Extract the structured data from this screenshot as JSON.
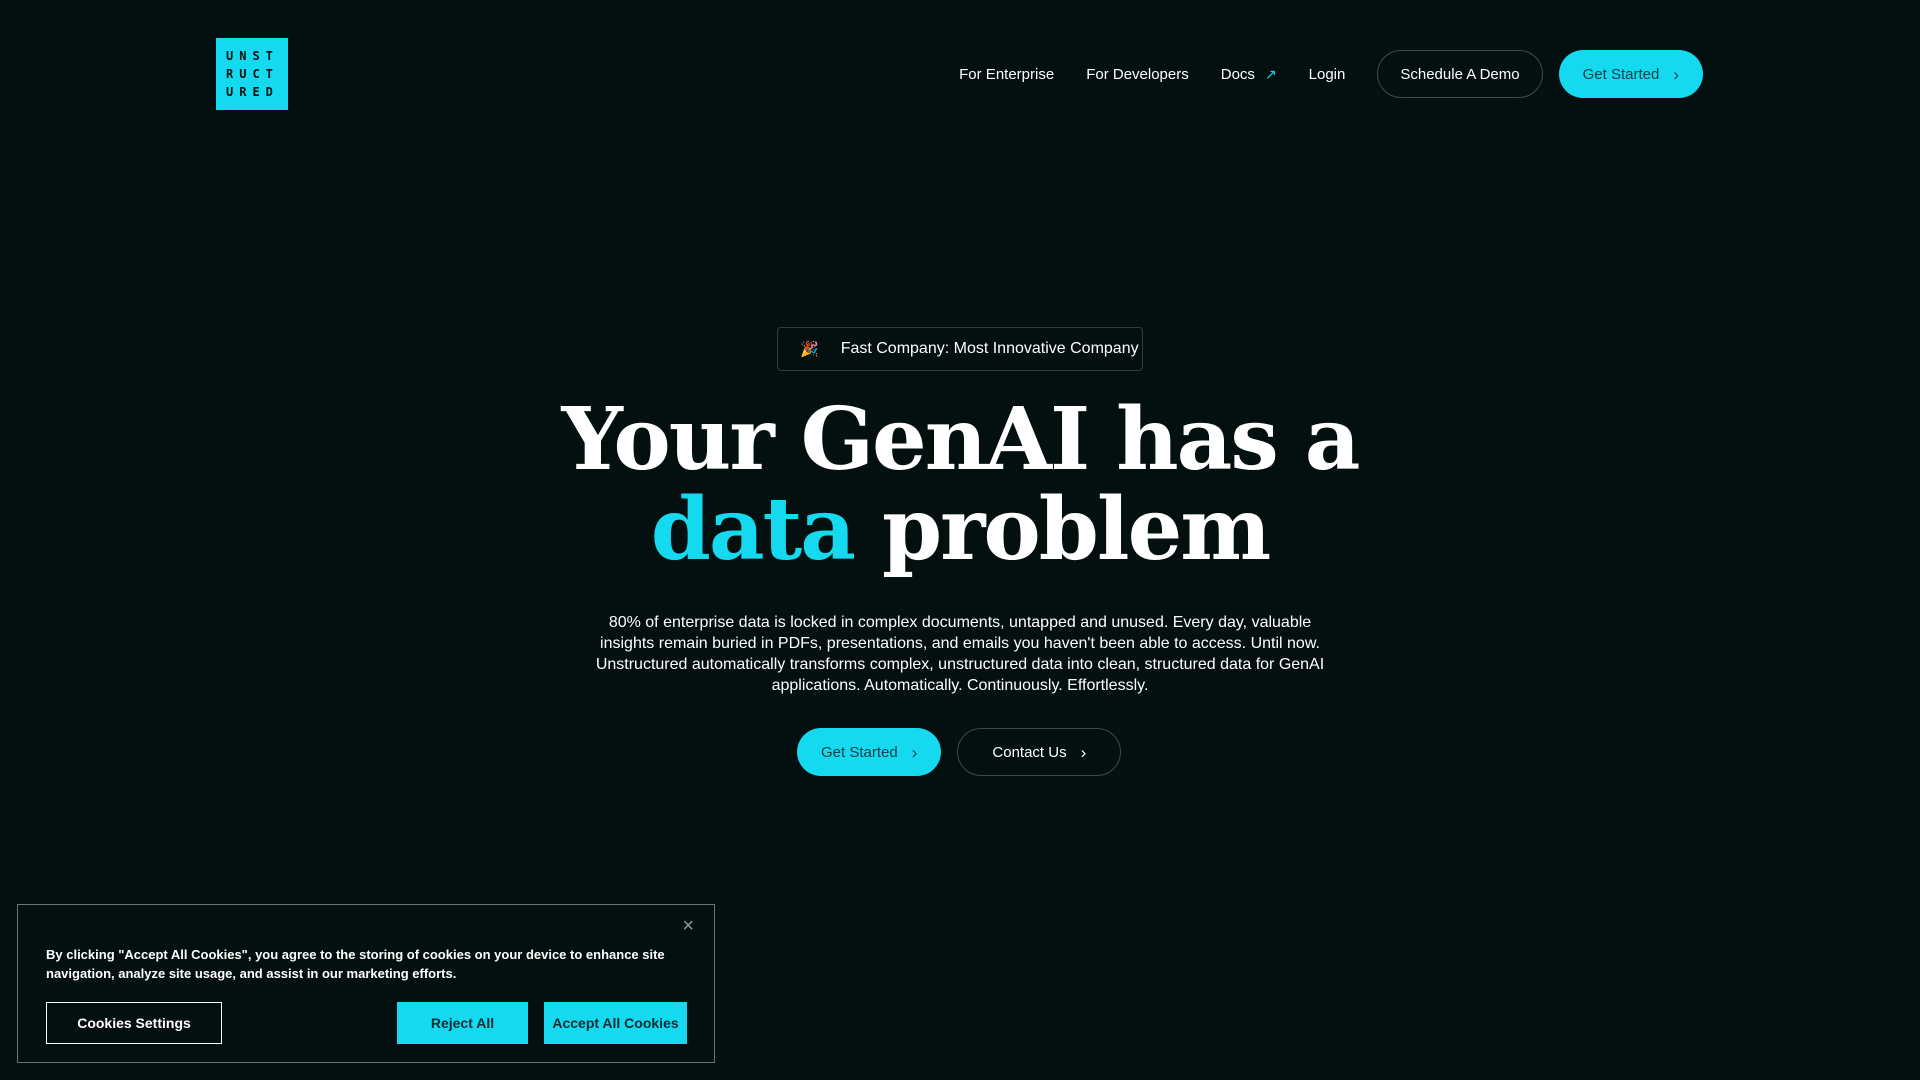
{
  "logo": {
    "lines": [
      "UNST",
      "RUCT",
      "URED"
    ]
  },
  "nav": {
    "enterprise": "For Enterprise",
    "developers": "For Developers",
    "docs": "Docs",
    "docs_icon": "↗",
    "login": "Login",
    "schedule_demo": "Schedule A Demo",
    "get_started": "Get Started"
  },
  "hero": {
    "badge_icon": "🎉",
    "badge_text": "Fast Company: Most Innovative Company",
    "headline_line1": "Your GenAI has a",
    "headline_accent": "data",
    "headline_rest": " problem",
    "subtext": "80% of enterprise data is locked in complex documents, untapped and unused. Every day, valuable insights remain buried in PDFs, presentations, and emails you haven't been able to access. Until now. Unstructured automatically transforms complex, unstructured data into clean, structured data for GenAI applications. Automatically. Continuously. Effortlessly.",
    "primary_cta": "Get Started",
    "secondary_cta": "Contact Us"
  },
  "cookie": {
    "close": "×",
    "text": "By clicking \"Accept All Cookies\", you agree to the storing of cookies on your device to enhance site navigation, analyze site usage, and assist in our marketing efforts.",
    "settings": "Cookies Settings",
    "reject": "Reject All",
    "accept": "Accept All Cookies"
  },
  "colors": {
    "accent": "#14d9ef",
    "background": "#03100f"
  },
  "icons": {
    "chevron": "chevron-right-icon",
    "docs": "external-link-icon",
    "badge": "party-popper-icon",
    "close": "close-icon"
  }
}
